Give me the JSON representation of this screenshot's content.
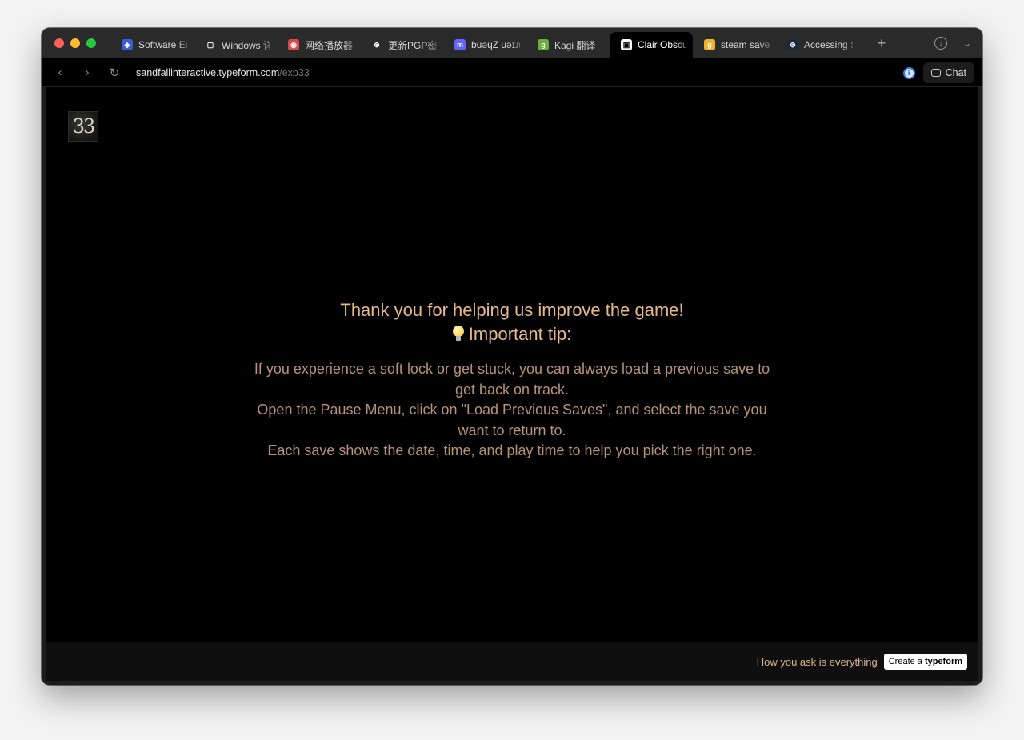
{
  "browser": {
    "tabs": [
      {
        "label": "Software En",
        "icon": "software-eng-icon",
        "icon_color": "#3a5bd6",
        "glyph": "◆"
      },
      {
        "label": "Windows 详",
        "icon": "chat-bubble-icon",
        "icon_color": "#2a2a2a",
        "glyph": "▢"
      },
      {
        "label": "网络播放器 -",
        "icon": "player-icon",
        "icon_color": "#e04848",
        "glyph": "◉"
      },
      {
        "label": "更新PGP密钥",
        "icon": "openai-icon",
        "icon_color": "#2a2a2a",
        "glyph": "⊛"
      },
      {
        "label": "ɓuәɥZ uәɪɹɐ",
        "icon": "mastodon-icon",
        "icon_color": "#6364ff",
        "glyph": "m"
      },
      {
        "label": "Kagi 翻译",
        "icon": "kagi-icon",
        "icon_color": "#6aae3c",
        "glyph": "g"
      },
      {
        "label": "Clair Obscur",
        "icon": "typeform-icon",
        "icon_color": "#ffffff",
        "glyph": "▣",
        "active": true
      },
      {
        "label": "steam saved",
        "icon": "kagi-search-icon",
        "icon_color": "#f0b429",
        "glyph": "g"
      },
      {
        "label": "Accessing S",
        "icon": "steam-icon",
        "icon_color": "#1b2838",
        "glyph": "⊚"
      }
    ],
    "new_tab": "+",
    "url_host": "sandfallinteractive.typeform.com",
    "url_path": "/exp33",
    "chat_label": "Chat",
    "password_icon_glyph": "i"
  },
  "page": {
    "logo_text": "33",
    "heading_line1": "Thank you for helping us improve the game!",
    "heading_line2": "Important tip:",
    "body_line1": "If you experience a soft lock or get stuck, you can always load a previous save to get back on track.",
    "body_line2": "Open the Pause Menu, click on \"Load Previous Saves\", and select the save you want to return to.",
    "body_line3": "Each save shows the date, time, and play time to help you pick the right one."
  },
  "footer": {
    "tagline": "How you ask is everything",
    "create_prefix": "Create a",
    "create_brand": "typeform"
  },
  "colors": {
    "heading": "#e6b98c",
    "body": "#b79276",
    "background": "#000000"
  }
}
